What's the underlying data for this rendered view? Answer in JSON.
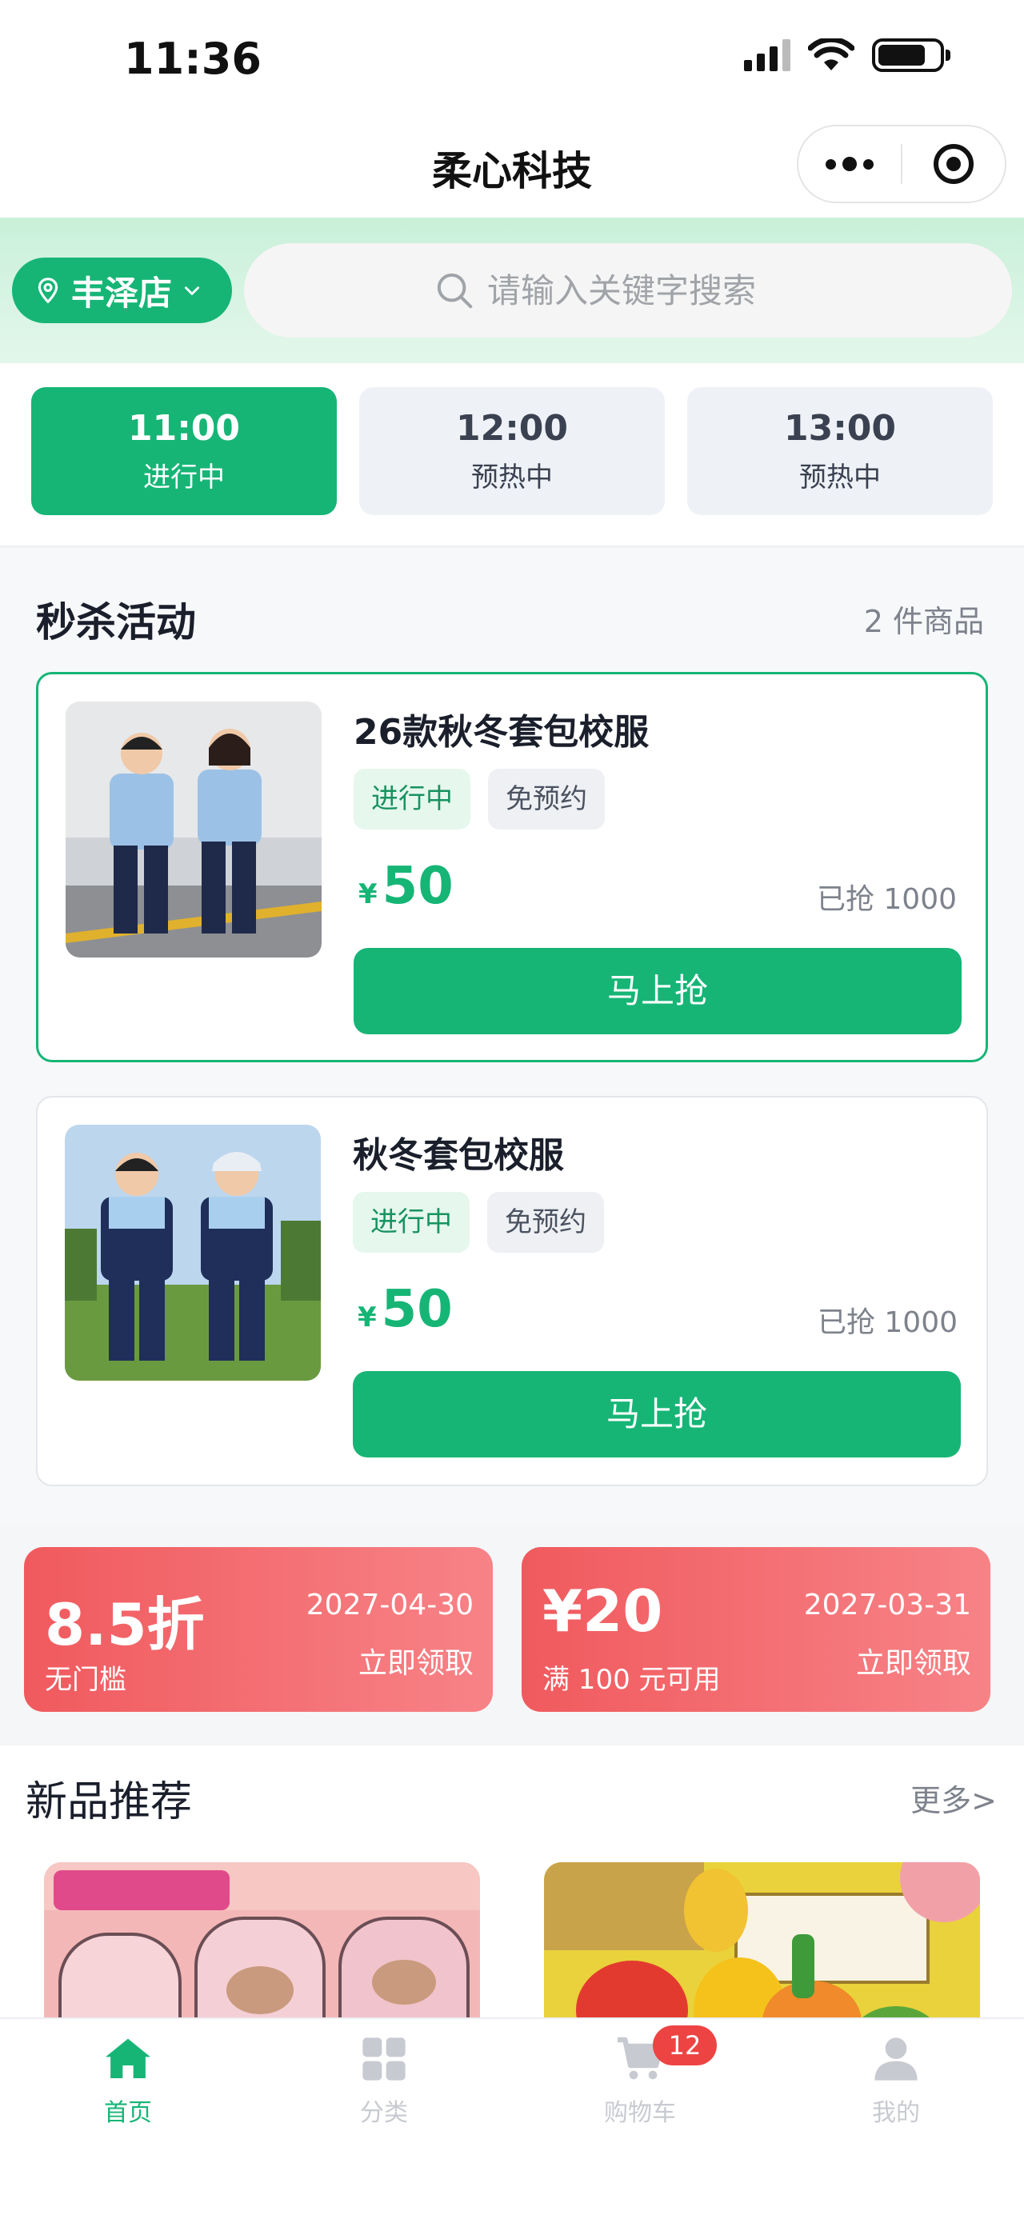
{
  "status_bar": {
    "time": "11:36"
  },
  "nav": {
    "title": "柔心科技"
  },
  "store": {
    "name": "丰泽店"
  },
  "search": {
    "placeholder": "请输入关键字搜索"
  },
  "time_tabs": [
    {
      "time": "11:00",
      "status": "进行中",
      "active": true
    },
    {
      "time": "12:00",
      "status": "预热中",
      "active": false
    },
    {
      "time": "13:00",
      "status": "预热中",
      "active": false
    }
  ],
  "seckill": {
    "title": "秒杀活动",
    "count": "2 件商品",
    "products": [
      {
        "name": "26款秋冬套包校服",
        "tag_status": "进行中",
        "tag_booking": "免预约",
        "currency": "¥",
        "price": "50",
        "sold": "已抢 1000",
        "buy_label": "马上抢"
      },
      {
        "name": "秋冬套包校服",
        "tag_status": "进行中",
        "tag_booking": "免预约",
        "currency": "¥",
        "price": "50",
        "sold": "已抢 1000",
        "buy_label": "马上抢"
      }
    ]
  },
  "coupons": [
    {
      "value": "8.5折",
      "condition": "无门槛",
      "expiry": "2027-04-30",
      "action": "立即领取"
    },
    {
      "value": "¥20",
      "condition": "满 100 元可用",
      "expiry": "2027-03-31",
      "action": "立即领取"
    }
  ],
  "new_products": {
    "title": "新品推荐",
    "more": "更多>",
    "images": [
      "pencil-case-product-image",
      "toy-vegetables-product-image"
    ]
  },
  "tab_bar": {
    "items": [
      {
        "label": "首页",
        "icon": "home-icon",
        "active": true
      },
      {
        "label": "分类",
        "icon": "category-icon",
        "active": false
      },
      {
        "label": "购物车",
        "icon": "cart-icon",
        "active": false,
        "badge": "12"
      },
      {
        "label": "我的",
        "icon": "user-icon",
        "active": false
      }
    ]
  },
  "colors": {
    "primary": "#16b576",
    "coupon": "#f05a5e",
    "badge": "#ee4343"
  }
}
